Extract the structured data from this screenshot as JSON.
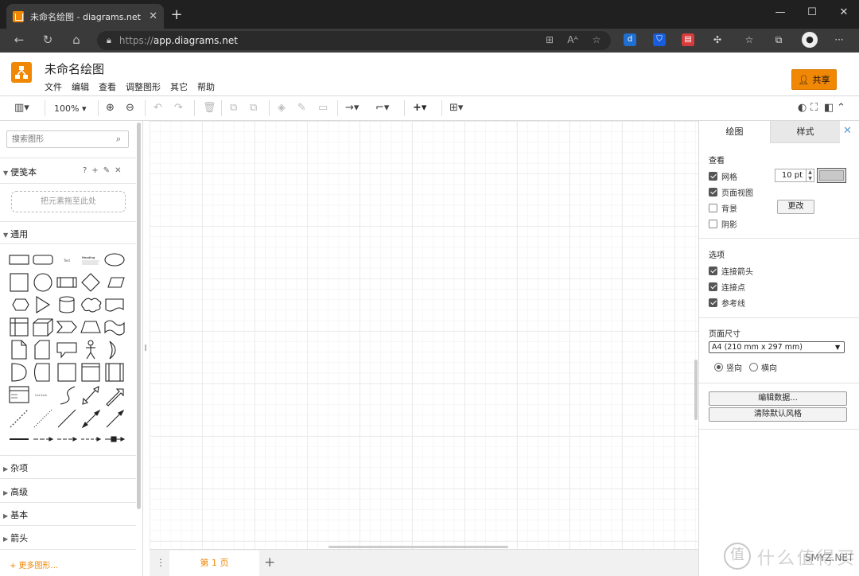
{
  "browser": {
    "tab_title": "未命名绘图 - diagrams.net",
    "url_scheme": "https://",
    "url_host": "app.diagrams.net"
  },
  "app": {
    "title": "未命名绘图",
    "menu": [
      "文件",
      "编辑",
      "查看",
      "调整图形",
      "其它",
      "帮助"
    ],
    "share_label": "共享",
    "brand_color": "#f08705"
  },
  "toolbar": {
    "zoom": "100%"
  },
  "sidebar": {
    "search_placeholder": "搜索图形",
    "scratchpad_title": "便笺本",
    "scratchpad_help": "?",
    "dropzone_text": "把元素拖至此处",
    "general_title": "通用",
    "sections": [
      "杂项",
      "高级",
      "基本",
      "箭头"
    ],
    "more_shapes": "+ 更多图形..."
  },
  "pages": {
    "current": "第 1 页"
  },
  "format_panel": {
    "tab_diagram": "绘图",
    "tab_style": "样式",
    "view_title": "查看",
    "grid_label": "网格",
    "grid_size": "10 pt",
    "page_view_label": "页面视图",
    "background_label": "背景",
    "change_button": "更改",
    "shadow_label": "阴影",
    "options_title": "选项",
    "connection_arrows": "连接箭头",
    "connection_points": "连接点",
    "guides": "参考线",
    "page_size_title": "页面尺寸",
    "page_size_value": "A4 (210 mm x 297 mm)",
    "portrait": "竖向",
    "landscape": "横向",
    "edit_data_button": "编辑数据...",
    "clear_style_button": "清除默认风格"
  },
  "watermark": {
    "glyph": "值",
    "text": "什么值得买",
    "site": "SMYZ.NET"
  }
}
